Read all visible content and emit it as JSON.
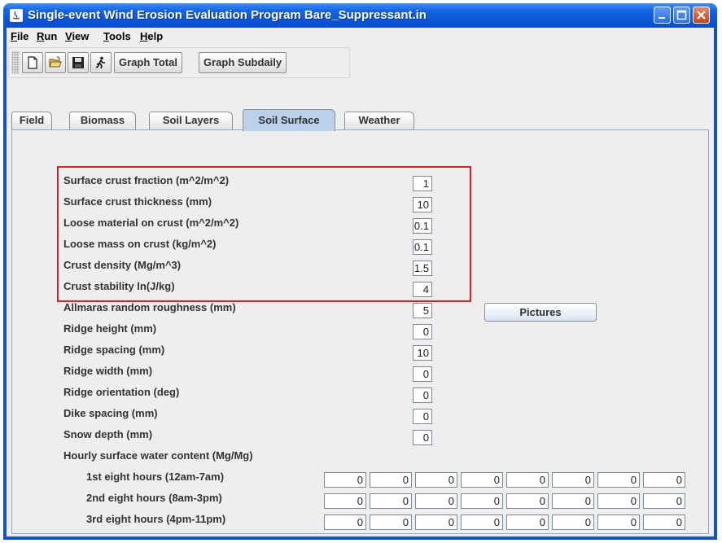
{
  "window": {
    "title": "Single-event Wind Erosion Evaluation Program Bare_Suppressant.in",
    "accent": "#0a53d6"
  },
  "menu": [
    {
      "label": "File",
      "underline": "F"
    },
    {
      "label": "Run",
      "underline": "R"
    },
    {
      "label": "View",
      "underline": "V"
    },
    {
      "label": "Tools",
      "underline": "T"
    },
    {
      "label": "Help",
      "underline": "H"
    }
  ],
  "toolbar": {
    "icons": [
      "new-file-icon",
      "open-folder-icon",
      "save-disk-icon",
      "run-person-icon"
    ],
    "graph_total": "Graph Total",
    "graph_subdaily": "Graph Subdaily"
  },
  "tabs": [
    {
      "label": "Field",
      "active": false
    },
    {
      "label": "Biomass",
      "active": false
    },
    {
      "label": "Soil Layers",
      "active": false
    },
    {
      "label": "Soil Surface",
      "active": true
    },
    {
      "label": "Weather",
      "active": false
    }
  ],
  "soil_surface": {
    "rows": [
      {
        "label": "Surface crust fraction (m^2/m^2)",
        "value": "1"
      },
      {
        "label": "Surface crust thickness (mm)",
        "value": "10"
      },
      {
        "label": "Loose material on crust (m^2/m^2)",
        "value": "0.1"
      },
      {
        "label": "Loose mass on crust (kg/m^2)",
        "value": "0.1"
      },
      {
        "label": "Crust density (Mg/m^3)",
        "value": "1.5"
      },
      {
        "label": "Crust stability ln(J/kg)",
        "value": "4"
      },
      {
        "label": "Allmaras random roughness (mm)",
        "value": "5"
      },
      {
        "label": "Ridge height (mm)",
        "value": "0"
      },
      {
        "label": "Ridge spacing (mm)",
        "value": "10"
      },
      {
        "label": "Ridge width (mm)",
        "value": "0"
      },
      {
        "label": "Ridge orientation (deg)",
        "value": "0"
      },
      {
        "label": "Dike spacing (mm)",
        "value": "0"
      },
      {
        "label": "Snow depth (mm)",
        "value": "0"
      }
    ],
    "pictures_label": "Pictures",
    "water_header": "Hourly surface water content (Mg/Mg)",
    "water_rows": [
      {
        "label": "1st eight hours (12am-7am)",
        "values": [
          "0",
          "0",
          "0",
          "0",
          "0",
          "0",
          "0",
          "0"
        ]
      },
      {
        "label": "2nd eight hours (8am-3pm)",
        "values": [
          "0",
          "0",
          "0",
          "0",
          "0",
          "0",
          "0",
          "0"
        ]
      },
      {
        "label": "3rd eight hours (4pm-11pm)",
        "values": [
          "0",
          "0",
          "0",
          "0",
          "0",
          "0",
          "0",
          "0"
        ]
      }
    ],
    "highlight_color": "#e02020"
  }
}
